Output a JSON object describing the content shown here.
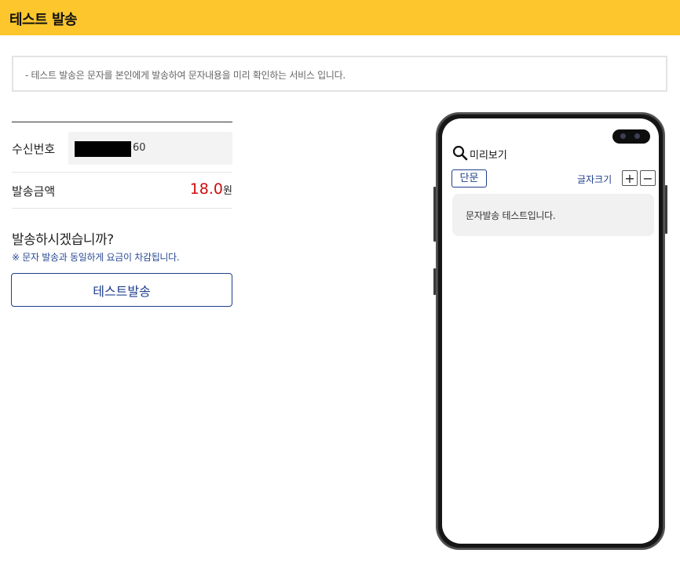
{
  "header": {
    "title": "테스트 발송"
  },
  "notice": {
    "text": "- 테스트 발송은 문자를 본인에게 발송하여 문자내용을 미리 확인하는 서비스 입니다."
  },
  "form": {
    "recipient_label": "수신번호",
    "recipient_value": "60",
    "amount_label": "발송금액",
    "amount_value": "18.0",
    "amount_unit": "원"
  },
  "confirm": {
    "question": "발송하시겠습니까?",
    "note": "※ 문자 발송과 동일하게 요금이 차감됩니다.",
    "button_label": "테스트발송"
  },
  "preview": {
    "title": "미리보기",
    "type_badge": "단문",
    "font_size_label": "글자크기",
    "plus": "+",
    "minus": "−",
    "message": "문자발송 테스트입니다."
  },
  "colors": {
    "header_bg": "#fcc62c",
    "accent_blue": "#1f3f8c",
    "amount_red": "#cc0d0d"
  }
}
